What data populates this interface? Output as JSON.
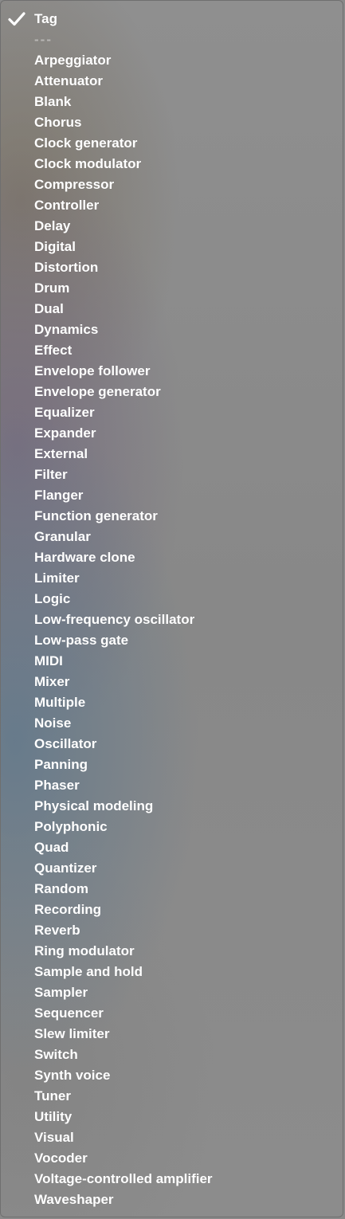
{
  "menu": {
    "selected": "Tag",
    "separator": "---",
    "items": [
      "Arpeggiator",
      "Attenuator",
      "Blank",
      "Chorus",
      "Clock generator",
      "Clock modulator",
      "Compressor",
      "Controller",
      "Delay",
      "Digital",
      "Distortion",
      "Drum",
      "Dual",
      "Dynamics",
      "Effect",
      "Envelope follower",
      "Envelope generator",
      "Equalizer",
      "Expander",
      "External",
      "Filter",
      "Flanger",
      "Function generator",
      "Granular",
      "Hardware clone",
      "Limiter",
      "Logic",
      "Low-frequency oscillator",
      "Low-pass gate",
      "MIDI",
      "Mixer",
      "Multiple",
      "Noise",
      "Oscillator",
      "Panning",
      "Phaser",
      "Physical modeling",
      "Polyphonic",
      "Quad",
      "Quantizer",
      "Random",
      "Recording",
      "Reverb",
      "Ring modulator",
      "Sample and hold",
      "Sampler",
      "Sequencer",
      "Slew limiter",
      "Switch",
      "Synth voice",
      "Tuner",
      "Utility",
      "Visual",
      "Vocoder",
      "Voltage-controlled amplifier",
      "Waveshaper"
    ],
    "colors": {
      "text": "#ffffff",
      "separator": "#c4c4c4",
      "background": "#8a8a8a"
    },
    "icons": {
      "selected": "checkmark-icon"
    }
  }
}
